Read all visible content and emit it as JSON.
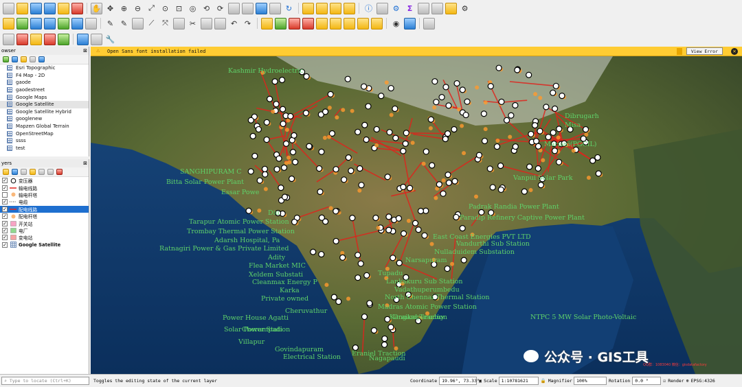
{
  "message_bar": {
    "text": "Open Sans font installation failed",
    "button": "View Error"
  },
  "browser_panel": {
    "title": "owser",
    "items": [
      "Esri Topographic",
      "F4 Map - 2D",
      "gaode",
      "gaodestreet",
      "Google Maps",
      "Google Satellite",
      "Google Satellite Hybrid",
      "googlenew",
      "Mapzen Global Terrain",
      "OpenStreetMap",
      "ssss",
      "test"
    ],
    "selected_index": 5
  },
  "layers_panel": {
    "title": "yers",
    "items": [
      {
        "label": "变压器",
        "checked": true,
        "symbol": "circle"
      },
      {
        "label": "输电线路",
        "checked": true,
        "symbol": "line-red"
      },
      {
        "label": "输电杆塔",
        "checked": false,
        "symbol": "dot-orange"
      },
      {
        "label": "电缆",
        "checked": true,
        "symbol": "dots"
      },
      {
        "label": "配电线路",
        "checked": true,
        "symbol": "line-red"
      },
      {
        "label": "配电杆塔",
        "checked": true,
        "symbol": "dot-orange"
      },
      {
        "label": "开关站",
        "checked": true,
        "symbol": "fill-pink"
      },
      {
        "label": "电厂",
        "checked": true,
        "symbol": "fill-green"
      },
      {
        "label": "变电站",
        "checked": true,
        "symbol": "fill-salmon"
      },
      {
        "label": "Google Satellite",
        "checked": true,
        "symbol": "xyz"
      }
    ],
    "selected_index": 4
  },
  "map_labels": [
    "SANGHIPURAM C",
    "Bitta Solar Power Plant",
    "Essar Powe",
    "Diu",
    "Tarapur Atomic Power Station",
    "Trombay Thermal Power Station",
    "Adarsh Hospital, Pa",
    "Ratnagiri Power & Gas Private Limited",
    "Adity",
    "Flea Market MIC",
    "Xeldem Substati",
    "Cleanmax Energy P",
    "Karka",
    "Private owned",
    "Cheruvathur",
    "Power House Agatti",
    "Cherampadi",
    "Solar Power Station",
    "Villapur",
    "Govindapuram",
    "Electrical Station",
    "Eraniel Traction",
    "Nagapaudi",
    "Ongamparuduy",
    "Karaikal Traction",
    "Madras Atomic Power Station",
    "North Chennai Thermal Station",
    "Vadathuperumbedu",
    "Lankakuru Sub Station",
    "Tupadu",
    "Narsapuram",
    "Nulladuidem Substation",
    "Vandurthi Sub Station",
    "East Coast Energies PVT LTD",
    "Paradip Refinery Captive Power Plant",
    "Padrak Randia Power Plant",
    "Vanpui Solar Park",
    "NTPC 5 MW Solar Photo-Voltaic",
    "Mariani(PGCIL)",
    "Misa",
    "Dibrugarh",
    "Kashmir Hydroelectric"
  ],
  "statusbar": {
    "locate_placeholder": "Type to locate (Ctrl+K)",
    "message": "Toggles the editing state of the current layer",
    "coord_label": "Coordinate",
    "coord_value": "19.96°, 73.33°",
    "scale_label": "Scale",
    "scale_value": "1:10781621",
    "magnifier_label": "Magnifier",
    "magnifier_value": "100%",
    "rotation_label": "Rotation",
    "rotation_value": "0.0 °",
    "render_label": "Render",
    "crs": "EPSG:4326"
  },
  "watermark": {
    "text": "公众号 · GIS工具",
    "subtext": "QQ群：1083040 微信：gisdatafactory"
  },
  "colors": {
    "label_green": "#5fd36a",
    "line_red": "#e0231c",
    "selection_blue": "#1e6fcf",
    "message_yellow": "#ffcc33"
  }
}
